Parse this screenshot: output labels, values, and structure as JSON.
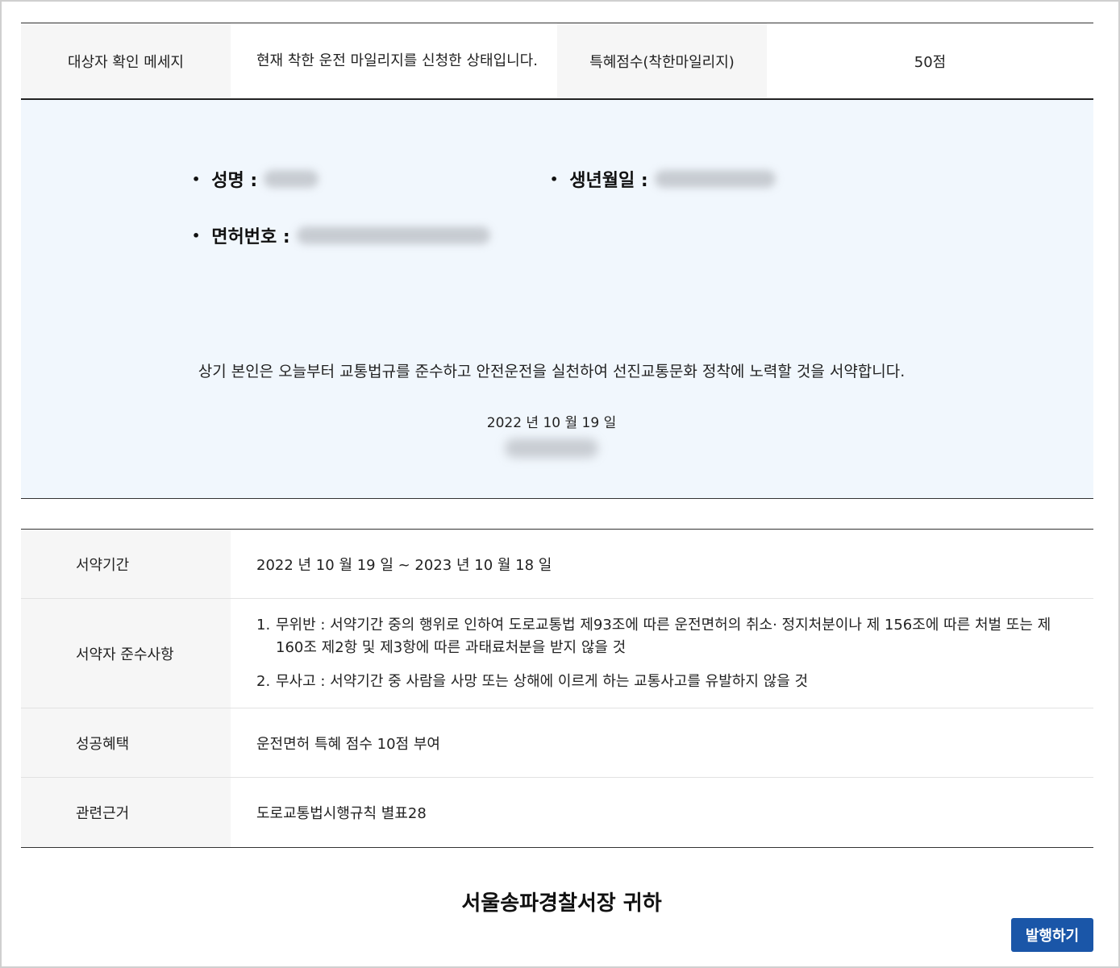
{
  "top_table": {
    "label_message": "대상자 확인 메세지",
    "message": "현재 착한 운전 마일리지를 신청한 상태입니다.",
    "label_points": "특혜점수(착한마일리지)",
    "points": "50점"
  },
  "pledge": {
    "name_label": "성명 :",
    "birth_label": "생년월일 :",
    "license_label": "면허번호 :",
    "statement": "상기 본인은 오늘부터 교통법규를 준수하고 안전운전을 실천하여 선진교통문화 정착에 노력할 것을 서약합니다.",
    "date": "2022 년 10 월 19 일"
  },
  "info_table": {
    "period_label": "서약기간",
    "period_value": "2022 년 10 월 19 일 ~ 2023 년 10 월 18 일",
    "rules_label": "서약자 준수사항",
    "rules": [
      {
        "num": "1.",
        "text": "무위반 : 서약기간 중의 행위로 인하여 도로교통법 제93조에 따른 운전면허의 취소· 정지처분이나 제 156조에 따른 처벌 또는 제 160조 제2항 및 제3항에 따른 과태료처분을 받지 않을 것"
      },
      {
        "num": "2.",
        "text": "무사고 : 서약기간 중 사람을 사망 또는 상해에 이르게 하는 교통사고를 유발하지 않을 것"
      }
    ],
    "benefit_label": "성공혜택",
    "benefit_value": "운전면허 특혜 점수 10점 부여",
    "basis_label": "관련근거",
    "basis_value": "도로교통법시행규칙 별표28"
  },
  "footer": {
    "title": "서울송파경찰서장 귀하",
    "issue_button": "발행하기"
  },
  "colors": {
    "pledge_background": "#f1f7fd",
    "header_cell_background": "#f6f6f6",
    "button": "#1a56a8"
  }
}
